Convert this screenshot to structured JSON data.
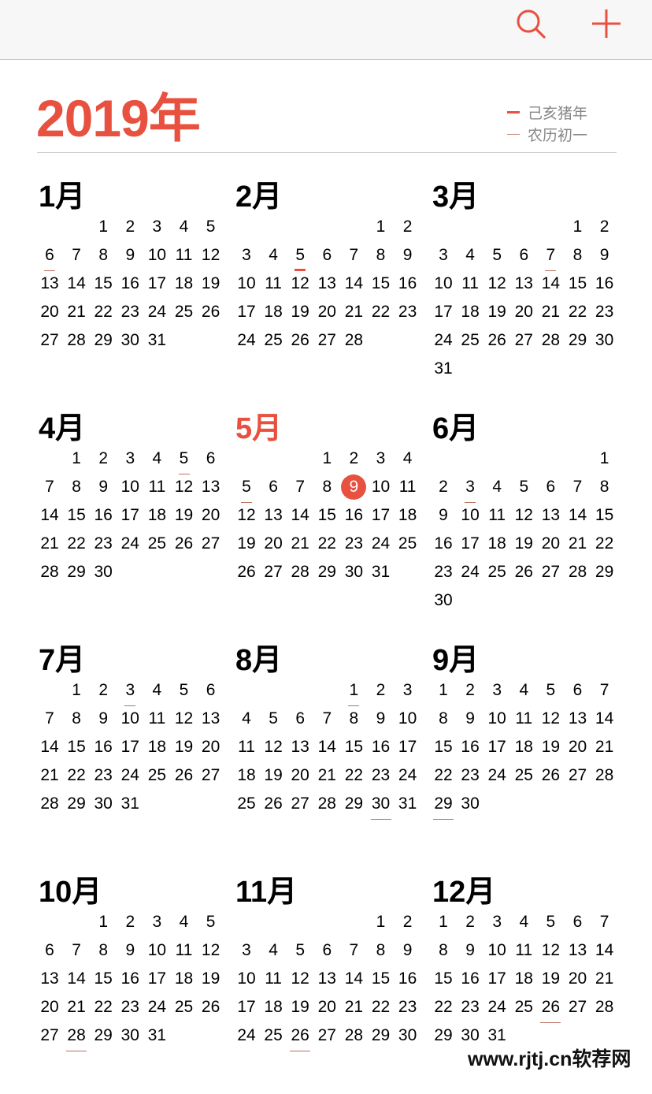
{
  "toolbar": {
    "search_icon": "search-icon",
    "add_icon": "plus-icon"
  },
  "header": {
    "year_title": "2019年"
  },
  "legend": {
    "zodiac": "己亥猪年",
    "lunar_first": "农历初一"
  },
  "colors": {
    "accent": "#e8503f",
    "text": "#000000",
    "muted": "#888888"
  },
  "today": {
    "month": 5,
    "day": 9
  },
  "months": [
    {
      "title": "1月",
      "first_weekday": 2,
      "length": 31,
      "thin_marks": [
        6
      ],
      "thick_marks": []
    },
    {
      "title": "2月",
      "first_weekday": 5,
      "length": 28,
      "thin_marks": [],
      "thick_marks": [
        5
      ]
    },
    {
      "title": "3月",
      "first_weekday": 5,
      "length": 31,
      "thin_marks": [
        7
      ],
      "thick_marks": []
    },
    {
      "title": "4月",
      "first_weekday": 1,
      "length": 30,
      "thin_marks": [
        5
      ],
      "thick_marks": []
    },
    {
      "title": "5月",
      "first_weekday": 3,
      "length": 31,
      "thin_marks": [
        5
      ],
      "thick_marks": []
    },
    {
      "title": "6月",
      "first_weekday": 6,
      "length": 30,
      "thin_marks": [
        3
      ],
      "thick_marks": []
    },
    {
      "title": "7月",
      "first_weekday": 1,
      "length": 31,
      "thin_marks": [
        3
      ],
      "thick_marks": []
    },
    {
      "title": "8月",
      "first_weekday": 4,
      "length": 31,
      "thin_marks": [
        1,
        30
      ],
      "thick_marks": []
    },
    {
      "title": "9月",
      "first_weekday": 0,
      "length": 30,
      "thin_marks": [
        29
      ],
      "thick_marks": []
    },
    {
      "title": "10月",
      "first_weekday": 2,
      "length": 31,
      "thin_marks": [
        28
      ],
      "thick_marks": []
    },
    {
      "title": "11月",
      "first_weekday": 5,
      "length": 30,
      "thin_marks": [
        26
      ],
      "thick_marks": []
    },
    {
      "title": "12月",
      "first_weekday": 0,
      "length": 31,
      "thin_marks": [
        26
      ],
      "thick_marks": []
    }
  ],
  "watermark": {
    "text": "www.rjtj.cn软荐网"
  }
}
